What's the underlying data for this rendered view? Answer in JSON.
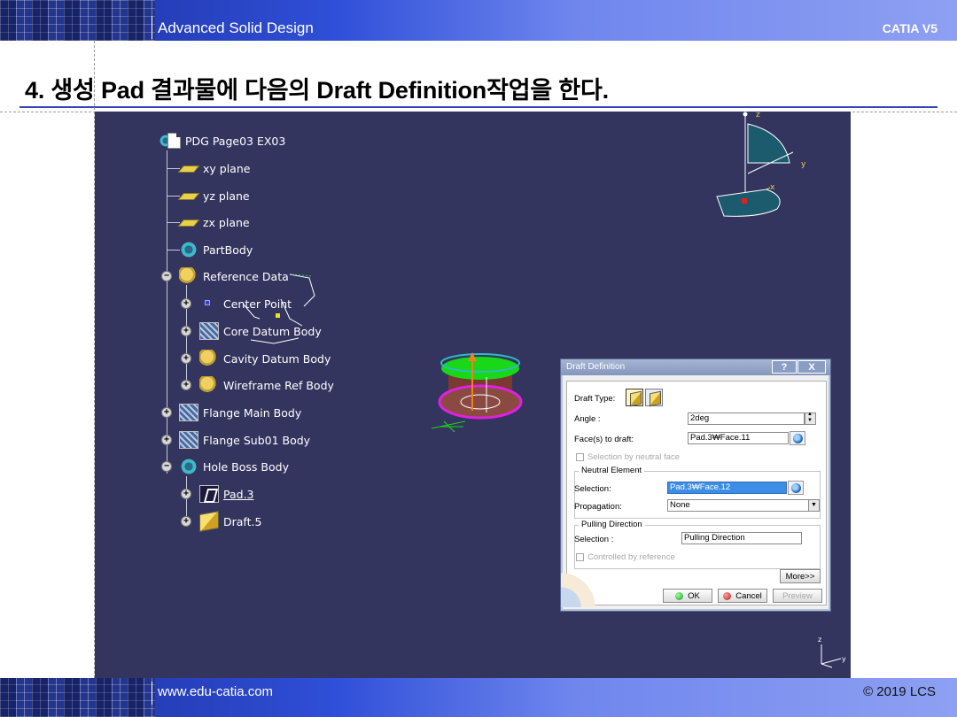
{
  "header": {
    "course": "Advanced Solid Design",
    "product": "CATIA V5"
  },
  "slide": {
    "heading": "4. 생성 Pad 결과물에 다음의 Draft Definition작업을 한다."
  },
  "footer": {
    "website": "www.edu-catia.com",
    "copyright": "© 2019 LCS"
  },
  "tree": {
    "root": "PDG Page03 EX03",
    "items": [
      {
        "label": "xy plane"
      },
      {
        "label": "yz plane"
      },
      {
        "label": "zx plane"
      },
      {
        "label": "PartBody"
      },
      {
        "label": "Reference Data"
      },
      {
        "label": "Center Point"
      },
      {
        "label": "Core Datum Body"
      },
      {
        "label": "Cavity Datum Body"
      },
      {
        "label": "Wireframe Ref Body"
      },
      {
        "label": "Flange Main Body"
      },
      {
        "label": "Flange Sub01 Body"
      },
      {
        "label": "Hole Boss Body"
      },
      {
        "label": "Pad.3"
      },
      {
        "label": "Draft.5"
      }
    ],
    "expand_plus": "+",
    "expand_minus": "−"
  },
  "compass": {
    "z": "z",
    "y": "y",
    "x": "x"
  },
  "mini_axis": {
    "z": "z",
    "y": "y"
  },
  "dialog": {
    "title": "Draft Definition",
    "help": "?",
    "close": "X",
    "draft_type_label": "Draft Type:",
    "angle_label": "Angle :",
    "angle_value": "2deg",
    "faces_label": "Face(s) to draft:",
    "faces_value": "Pad.3₩Face.11",
    "selection_by_neutral_label": "Selection by neutral face",
    "neutral_group": "Neutral Element",
    "neutral_selection_label": "Selection:",
    "neutral_selection_value": "Pad.3₩Face.12",
    "propagation_label": "Propagation:",
    "propagation_value": "None",
    "pulling_group": "Pulling Direction",
    "pulling_selection_label": "Selection :",
    "pulling_selection_value": "Pulling Direction",
    "controlled_label": "Controlled by reference",
    "more_button": "More>>",
    "ok_button": "OK",
    "cancel_button": "Cancel",
    "preview_button": "Preview"
  },
  "colors": {
    "viewport_bg": "#34355f",
    "band_blue": "#2f4fd8",
    "heading_rule": "#3845b8",
    "selected_field": "#3a8ee6",
    "pad_top": "#18d818",
    "pad_ring": "#e020e0",
    "pad_side": "#7a3a30"
  }
}
